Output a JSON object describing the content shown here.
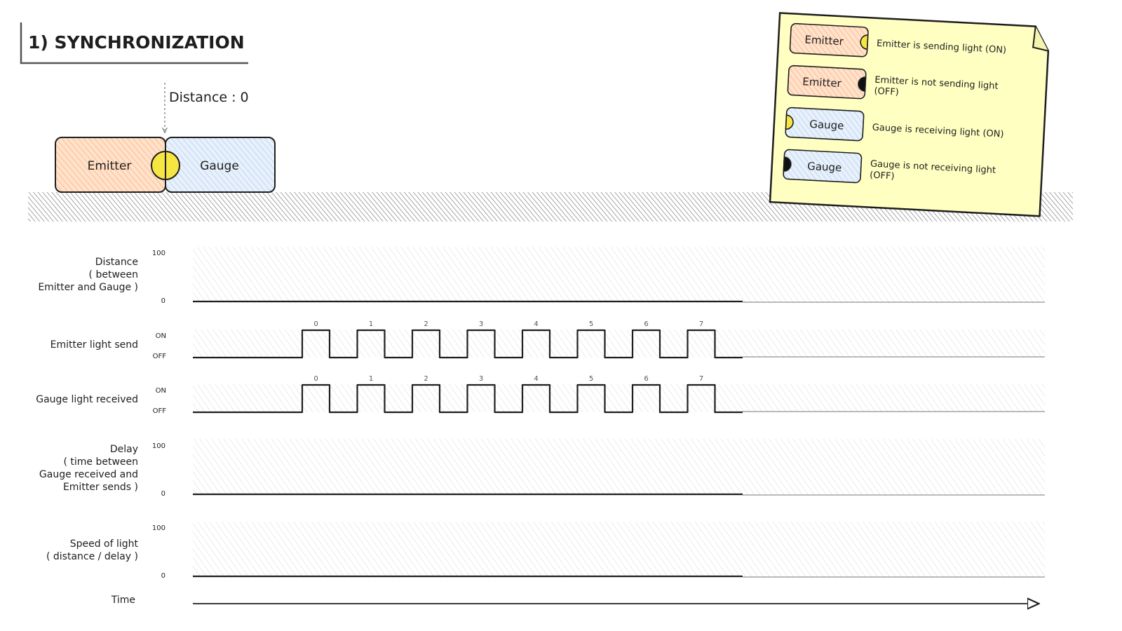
{
  "title": "1) SYNCHRONIZATION",
  "distance_label": "Distance : 0",
  "scene": {
    "emitter_label": "Emitter",
    "gauge_label": "Gauge"
  },
  "legend": {
    "items": [
      {
        "box_label": "Emitter",
        "desc": "Emitter is sending light (ON)"
      },
      {
        "box_label": "Emitter",
        "desc_line1": "Emitter is not sending light",
        "desc_line2": "(OFF)"
      },
      {
        "box_label": "Gauge",
        "desc": "Gauge is receiving light (ON)"
      },
      {
        "box_label": "Gauge",
        "desc_line1": "Gauge is not receiving light",
        "desc_line2": "(OFF)"
      }
    ]
  },
  "tracks": {
    "distance": {
      "label_lines": [
        "Distance",
        "( between",
        "Emitter and Gauge )"
      ],
      "max": "100",
      "min": "0",
      "value": 0
    },
    "emitter": {
      "label": "Emitter light send",
      "on": "ON",
      "off": "OFF"
    },
    "gauge": {
      "label": "Gauge light received",
      "on": "ON",
      "off": "OFF"
    },
    "delay": {
      "label_lines": [
        "Delay",
        "( time between",
        "Gauge received and",
        "Emitter sends )"
      ],
      "max": "100",
      "min": "0",
      "value": 0
    },
    "speed": {
      "label_lines": [
        "Speed of light",
        "( distance / delay )"
      ],
      "max": "100",
      "min": "0",
      "value": 0
    },
    "time": {
      "label": "Time"
    }
  },
  "pulses": [
    "0",
    "1",
    "2",
    "3",
    "4",
    "5",
    "6",
    "7"
  ],
  "colors": {
    "emitter_fill": "#ffc9a3",
    "gauge_fill": "#cfe3f7",
    "light_on": "#f5e642",
    "light_off": "#111111",
    "legend_bg": "#ffffc2",
    "hatch": "#cccccc",
    "ink": "#1e1e1e"
  }
}
